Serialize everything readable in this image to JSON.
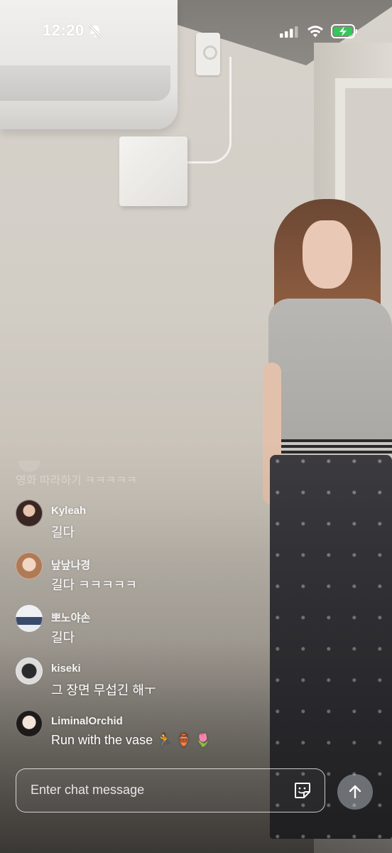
{
  "status_bar": {
    "time": "12:20",
    "icons": [
      "bell-slash-icon",
      "cellular-signal-icon",
      "wifi-icon",
      "battery-charging-icon"
    ]
  },
  "chat": {
    "system_line": "영화 따라하기 ㅋㅋㅋㅋㅋ",
    "messages": [
      {
        "username": "Kyleah",
        "text": "길다",
        "avatar_color": "#5a3b32"
      },
      {
        "username": "낲낲나경",
        "text": "길다 ㅋㅋㅋㅋㅋ",
        "avatar_color": "#c79a7b"
      },
      {
        "username": "뽀노야손",
        "text": "길다",
        "avatar_color": "#dfe3ea"
      },
      {
        "username": "kiseki",
        "text": "그 장면 무섭긴 해ㅜ",
        "avatar_color": "#4b4b4b"
      },
      {
        "username": "LiminalOrchid",
        "text": "Run with the vase 🏃 🏺 🌷",
        "avatar_color": "#2f2a2a"
      }
    ]
  },
  "input": {
    "placeholder": "Enter chat message",
    "value": ""
  },
  "colors": {
    "text": "#ffffff",
    "send_button_bg": "#c8d0d6",
    "battery_green": "#34c759"
  }
}
